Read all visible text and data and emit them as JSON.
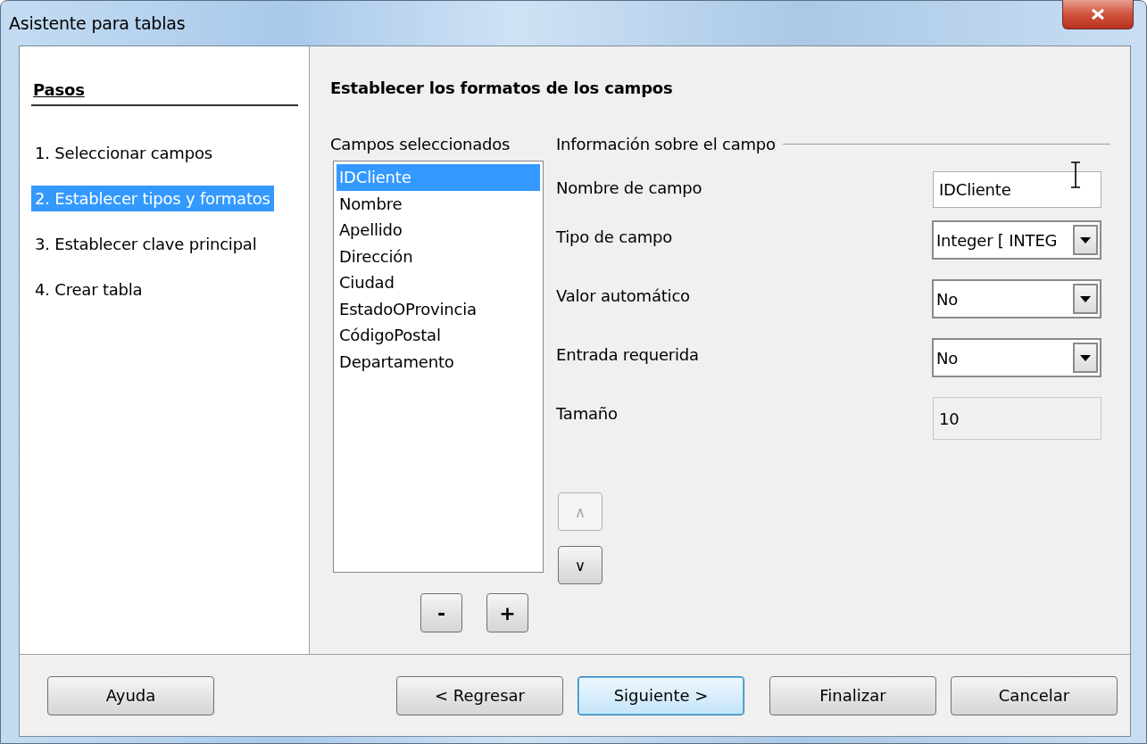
{
  "window": {
    "title": "Asistente para tablas"
  },
  "steps": {
    "title": "Pasos",
    "items": [
      {
        "label": "1. Seleccionar campos",
        "selected": false
      },
      {
        "label": "2. Establecer tipos y formatos",
        "selected": true
      },
      {
        "label": "3. Establecer clave principal",
        "selected": false
      },
      {
        "label": "4. Crear tabla",
        "selected": false
      }
    ]
  },
  "page_title": "Establecer los formatos de los campos",
  "fields_list": {
    "label": "Campos seleccionados",
    "items": [
      {
        "label": "IDCliente",
        "selected": true
      },
      {
        "label": "Nombre",
        "selected": false
      },
      {
        "label": "Apellido",
        "selected": false
      },
      {
        "label": "Dirección",
        "selected": false
      },
      {
        "label": "Ciudad",
        "selected": false
      },
      {
        "label": "EstadoOProvincia",
        "selected": false
      },
      {
        "label": "CódigoPostal",
        "selected": false
      },
      {
        "label": "Departamento",
        "selected": false
      }
    ]
  },
  "list_buttons": [
    {
      "label": "-"
    },
    {
      "label": "+"
    }
  ],
  "field_info": {
    "title": "Información sobre el campo",
    "rows": [
      {
        "kind": "text",
        "label": "Nombre de campo",
        "value": "IDCliente",
        "disabled": false
      },
      {
        "kind": "combo",
        "label": "Tipo de campo",
        "value": "Integer [ INTEG"
      },
      {
        "kind": "combo",
        "label": "Valor automático",
        "value": "No"
      },
      {
        "kind": "combo",
        "label": "Entrada requerida",
        "value": "No"
      },
      {
        "kind": "text",
        "label": "Tamaño",
        "value": "10",
        "disabled": true
      }
    ]
  },
  "order_buttons": [
    {
      "label": "∧",
      "disabled": true
    },
    {
      "label": "∨",
      "disabled": false
    }
  ],
  "buttons": [
    {
      "label": "Ayuda",
      "default": false
    },
    {
      "label": "< Regresar",
      "default": false
    },
    {
      "label": "Siguiente >",
      "default": true
    },
    {
      "label": "Finalizar",
      "default": false
    },
    {
      "label": "Cancelar",
      "default": false
    }
  ]
}
